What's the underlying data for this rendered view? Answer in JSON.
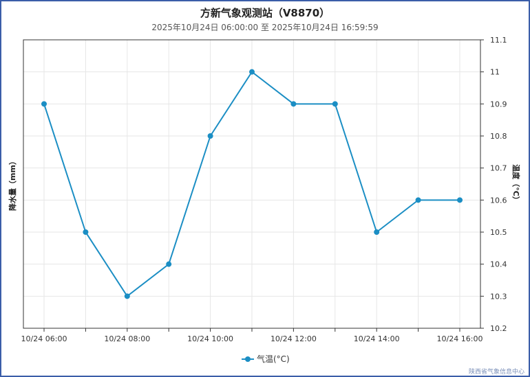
{
  "title": "方新气象观测站（V8870）",
  "subtitle": "2025年10月24日 06:00:00 至 2025年10月24日 16:59:59",
  "credit": "陕西省气象信息中心",
  "colors": {
    "series": "#1b8ec4",
    "frame": "#3a5da8",
    "grid": "#e6e6e6"
  },
  "chart_data": {
    "type": "line",
    "x_tick_labels": [
      "10/24 06:00",
      "10/24 08:00",
      "10/24 10:00",
      "10/24 12:00",
      "10/24 14:00",
      "10/24 16:00"
    ],
    "x": [
      "06:00",
      "07:00",
      "08:00",
      "09:00",
      "10:00",
      "11:00",
      "12:00",
      "13:00",
      "14:00",
      "15:00",
      "16:00"
    ],
    "series": [
      {
        "name": "气温(°C)",
        "axis": "right",
        "values": [
          10.9,
          10.5,
          10.3,
          10.4,
          10.8,
          11.0,
          10.9,
          10.9,
          10.5,
          10.6,
          10.6
        ]
      }
    ],
    "y_left_label": "降水量（mm）",
    "y_right_label": "温度（°C）",
    "y_right_range": [
      10.2,
      11.1
    ],
    "y_right_ticks": [
      "10.2",
      "10.3",
      "10.4",
      "10.5",
      "10.6",
      "10.7",
      "10.8",
      "10.9",
      "11",
      "11.1"
    ],
    "grid": true,
    "legend_position": "bottom-center"
  }
}
